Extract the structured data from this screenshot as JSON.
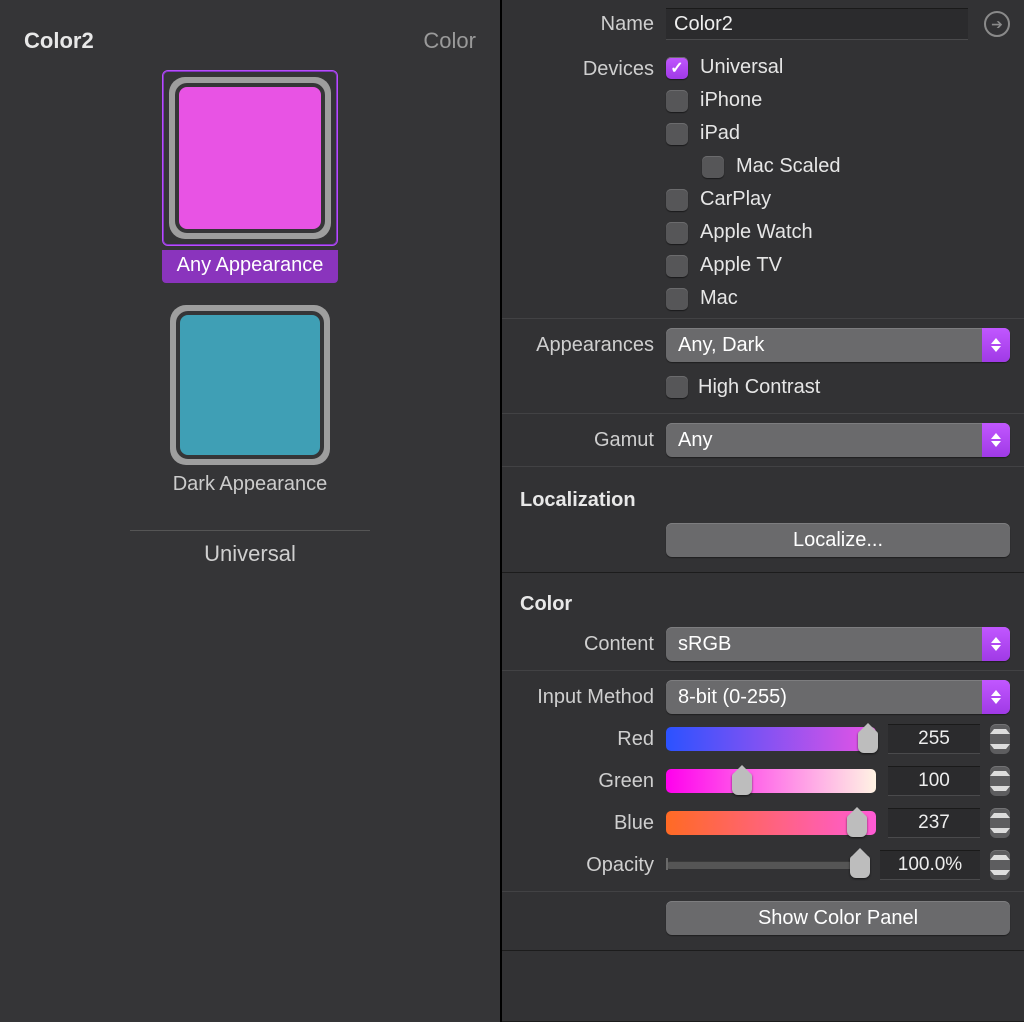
{
  "asset": {
    "title": "Color2",
    "type_label": "Color",
    "swatches": [
      {
        "label": "Any Appearance",
        "color": "#e853e4",
        "selected": true
      },
      {
        "label": "Dark Appearance",
        "color": "#3f9fb5",
        "selected": false
      }
    ],
    "group_label": "Universal"
  },
  "inspector": {
    "name_label": "Name",
    "name_value": "Color2",
    "devices_label": "Devices",
    "devices": [
      {
        "label": "Universal",
        "checked": true,
        "indent": 0
      },
      {
        "label": "iPhone",
        "checked": false,
        "indent": 0
      },
      {
        "label": "iPad",
        "checked": false,
        "indent": 0
      },
      {
        "label": "Mac Scaled",
        "checked": false,
        "indent": 1
      },
      {
        "label": "CarPlay",
        "checked": false,
        "indent": 0
      },
      {
        "label": "Apple Watch",
        "checked": false,
        "indent": 0
      },
      {
        "label": "Apple TV",
        "checked": false,
        "indent": 0
      },
      {
        "label": "Mac",
        "checked": false,
        "indent": 0
      }
    ],
    "appearances_label": "Appearances",
    "appearances_value": "Any, Dark",
    "high_contrast_label": "High Contrast",
    "high_contrast_checked": false,
    "gamut_label": "Gamut",
    "gamut_value": "Any",
    "localization_title": "Localization",
    "localize_button": "Localize...",
    "color_title": "Color",
    "content_label": "Content",
    "content_value": "sRGB",
    "input_method_label": "Input Method",
    "input_method_value": "8-bit (0-255)",
    "channels": {
      "red": {
        "label": "Red",
        "value": "255",
        "thumb_pct": 96,
        "gradient": "linear-gradient(90deg,#2b52ff,#e853e4)"
      },
      "green": {
        "label": "Green",
        "value": "100",
        "thumb_pct": 36,
        "gradient": "linear-gradient(90deg,#ff00ed,#fff3e3)"
      },
      "blue": {
        "label": "Blue",
        "value": "237",
        "thumb_pct": 91,
        "gradient": "linear-gradient(90deg,#ff6a24,#ff5bd6)"
      }
    },
    "opacity_label": "Opacity",
    "opacity_value": "100.0%",
    "opacity_thumb_pct": 96,
    "show_panel_button": "Show Color Panel"
  },
  "colors": {
    "accent": "#a03ae6"
  }
}
